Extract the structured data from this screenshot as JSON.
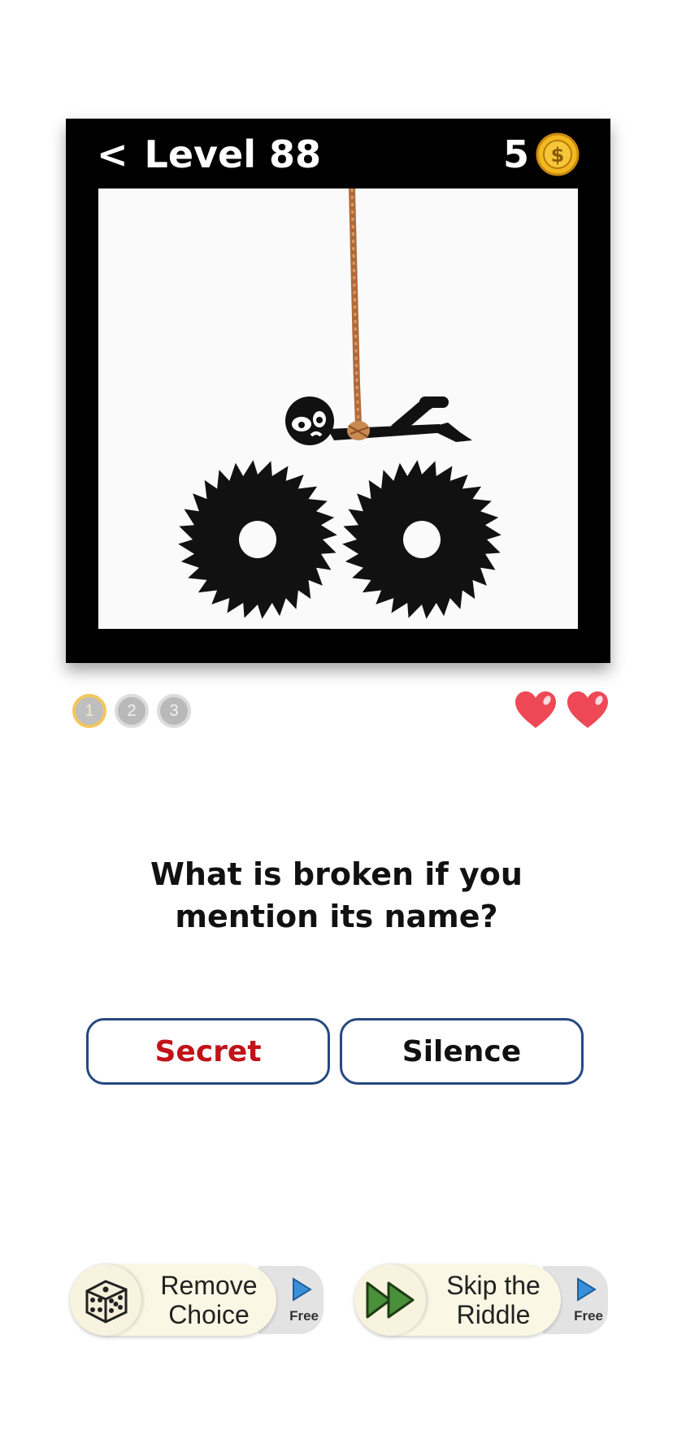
{
  "header": {
    "back_symbol": "<",
    "level_title": "Level 88",
    "coin_count": "5",
    "coin_symbol": "$"
  },
  "scene": {
    "description_icons": [
      "rope-icon",
      "stickman-icon",
      "saw-blade-icon"
    ]
  },
  "progress": {
    "steps": [
      "1",
      "2",
      "3"
    ],
    "current": 1
  },
  "lives": {
    "count": 2,
    "color": "#ee4857"
  },
  "question": {
    "line1": "What is broken if you",
    "line2": "mention its name?"
  },
  "answers": [
    {
      "label": "Secret",
      "color": "#c0141a"
    },
    {
      "label": "Silence",
      "color": "#111111"
    }
  ],
  "powerups": [
    {
      "line1": "Remove",
      "line2": "Choice",
      "icon": "dice-icon",
      "tag": "Free"
    },
    {
      "line1": "Skip the",
      "line2": "Riddle",
      "icon": "fast-forward-icon",
      "tag": "Free"
    }
  ],
  "colors": {
    "frame": "#000000",
    "button_border": "#26497f",
    "coin": "#f3b820",
    "play_accent": "#3a8fd9"
  }
}
